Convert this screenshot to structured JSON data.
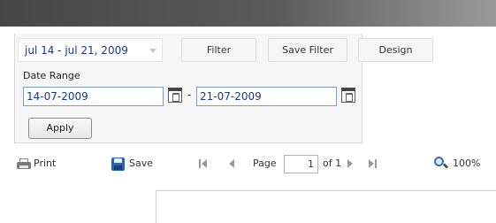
{
  "filter": {
    "date_range_selected": "jul 14 - jul 21, 2009",
    "filter_label": "Filter",
    "save_filter_label": "Save Filter",
    "design_label": "Design",
    "date_range_label": "Date Range",
    "start_date": "14-07-2009",
    "separator": "-",
    "end_date": "21-07-2009",
    "apply_label": "Apply"
  },
  "toolbar": {
    "print_label": "Print",
    "save_label": "Save",
    "page_label": "Page",
    "page_value": "1",
    "page_of": "of 1",
    "zoom_label": "100%"
  },
  "icons": {
    "print": "printer-icon",
    "save": "floppy-disk-icon",
    "first": "first-page-icon",
    "prev": "previous-page-icon",
    "next": "next-page-icon",
    "last": "last-page-icon",
    "zoom": "magnifier-icon",
    "calendar": "calendar-icon",
    "dropdown": "chevron-down-icon"
  },
  "colors": {
    "titlebar_dark": "#474747",
    "titlebar_light": "#9a9a9a",
    "link_text": "#1a3a80",
    "input_border": "#7f9db9"
  }
}
